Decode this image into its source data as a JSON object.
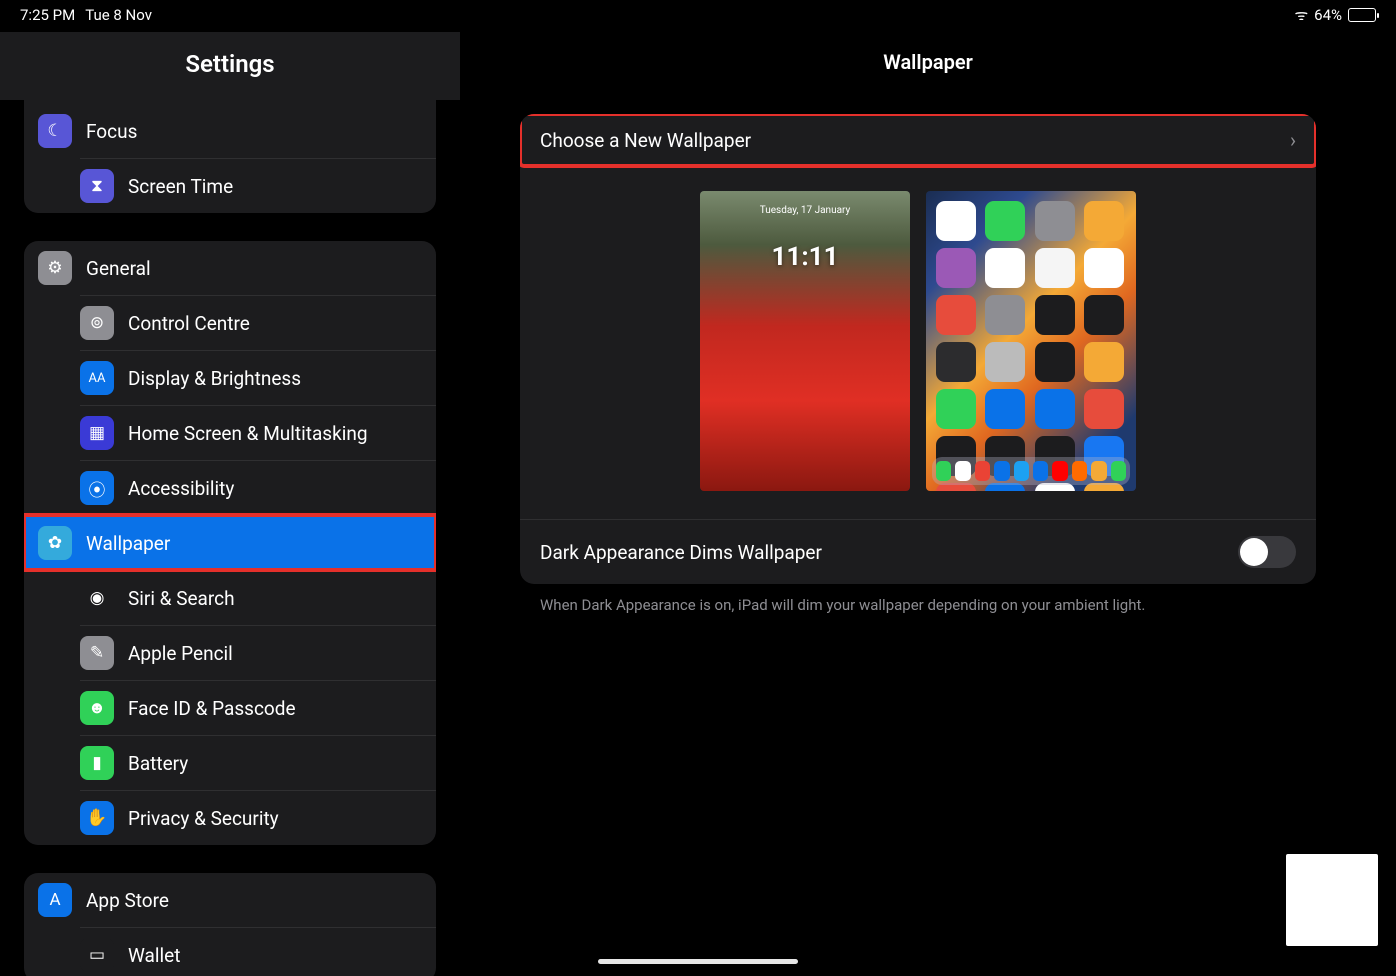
{
  "status": {
    "time": "7:25 PM",
    "date": "Tue 8 Nov",
    "battery": "64%"
  },
  "sidebar": {
    "title": "Settings",
    "group1": [
      {
        "label": "Focus",
        "icon_bg": "#5856d6",
        "glyph": "☾"
      },
      {
        "label": "Screen Time",
        "icon_bg": "#5856d6",
        "glyph": "⧗"
      }
    ],
    "group2": [
      {
        "label": "General",
        "icon_bg": "#8e8e93",
        "glyph": "⚙"
      },
      {
        "label": "Control Centre",
        "icon_bg": "#8e8e93",
        "glyph": "⊚"
      },
      {
        "label": "Display & Brightness",
        "icon_bg": "#0a72e8",
        "glyph": "AA"
      },
      {
        "label": "Home Screen & Multitasking",
        "icon_bg": "#3a3ad6",
        "glyph": "▦"
      },
      {
        "label": "Accessibility",
        "icon_bg": "#0a72e8",
        "glyph": "⦿"
      },
      {
        "label": "Wallpaper",
        "icon_bg": "#34aadc",
        "glyph": "✿",
        "active": true,
        "highlight": true
      },
      {
        "label": "Siri & Search",
        "icon_bg": "#1c1c1e",
        "glyph": "◉"
      },
      {
        "label": "Apple Pencil",
        "icon_bg": "#8e8e93",
        "glyph": "✎"
      },
      {
        "label": "Face ID & Passcode",
        "icon_bg": "#30d158",
        "glyph": "☻"
      },
      {
        "label": "Battery",
        "icon_bg": "#30d158",
        "glyph": "▮"
      },
      {
        "label": "Privacy & Security",
        "icon_bg": "#0a72e8",
        "glyph": "✋"
      }
    ],
    "group3": [
      {
        "label": "App Store",
        "icon_bg": "#0a72e8",
        "glyph": "A"
      },
      {
        "label": "Wallet",
        "icon_bg": "#1c1c1e",
        "glyph": "▭"
      }
    ]
  },
  "main": {
    "title": "Wallpaper",
    "choose_label": "Choose a New Wallpaper",
    "choose_highlight": true,
    "lock_preview": {
      "time": "11:11",
      "date": "Tuesday, 17 January"
    },
    "dark_dims_label": "Dark Appearance Dims Wallpaper",
    "dark_dims_on": false,
    "footer": "When Dark Appearance is on, iPad will dim your wallpaper depending on your ambient light."
  },
  "app_colors": [
    "#fff",
    "#30d158",
    "#8e8e93",
    "#f4a936",
    "#9b59b6",
    "#fff",
    "#f5f5f5",
    "#fff",
    "#e74c3c",
    "#8e8e93",
    "#1c1c1e",
    "#1c1c1e",
    "#2c2c2e",
    "#bbb",
    "#1c1c1e",
    "#f4a936",
    "#30d158",
    "#0a72e8",
    "#0a72e8",
    "#e74c3c",
    "#1c1c1e",
    "#1c1c1e",
    "#1c1c1e",
    "#1877f2",
    "#e74c3c",
    "#0a72e8",
    "#fff",
    "#f4a936"
  ],
  "dock_colors": [
    "#30d158",
    "#fff",
    "#ea4335",
    "#0a72e8",
    "#1da1f2",
    "#0a72e8",
    "#ff0000",
    "#ff6b00",
    "#f4a936",
    "#30d158"
  ]
}
